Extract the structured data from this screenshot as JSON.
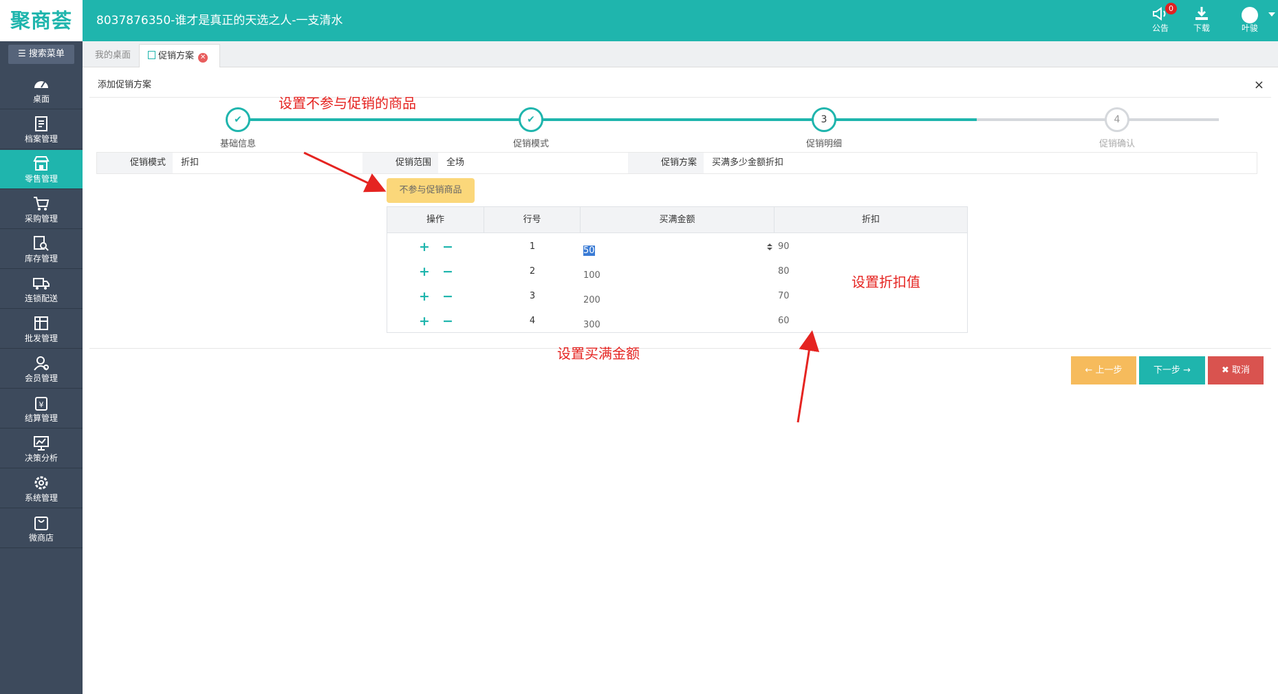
{
  "app": {
    "logo": "聚商荟",
    "title": "8037876350-谁才是真正的天选之人-一支清水",
    "notice_label": "公告",
    "notice_count": "0",
    "download_label": "下载",
    "user_name": "叶骏"
  },
  "sidebar": {
    "search_label": "搜索菜单",
    "items": [
      {
        "label": "桌面",
        "icon": "dashboard-icon"
      },
      {
        "label": "档案管理",
        "icon": "archive-icon"
      },
      {
        "label": "零售管理",
        "icon": "store-icon",
        "active": true
      },
      {
        "label": "采购管理",
        "icon": "cart-icon"
      },
      {
        "label": "库存管理",
        "icon": "inventory-search-icon"
      },
      {
        "label": "连锁配送",
        "icon": "truck-icon"
      },
      {
        "label": "批发管理",
        "icon": "wholesale-icon"
      },
      {
        "label": "会员管理",
        "icon": "member-icon"
      },
      {
        "label": "结算管理",
        "icon": "settlement-icon"
      },
      {
        "label": "决策分析",
        "icon": "analysis-icon"
      },
      {
        "label": "系统管理",
        "icon": "gear-icon"
      },
      {
        "label": "微商店",
        "icon": "shop-bag-icon"
      }
    ]
  },
  "tabs": {
    "desktop": "我的桌面",
    "promo": "促销方案"
  },
  "panel": {
    "title": "添加促销方案",
    "close": "×"
  },
  "steps": [
    {
      "number": "1",
      "label": "基础信息",
      "state": "done"
    },
    {
      "number": "2",
      "label": "促销模式",
      "state": "done"
    },
    {
      "number": "3",
      "label": "促销明细",
      "state": "current"
    },
    {
      "number": "4",
      "label": "促销确认",
      "state": "todo"
    }
  ],
  "info": {
    "mode_label": "促销模式",
    "mode_value": "折扣",
    "scope_label": "促销范围",
    "scope_value": "全场",
    "plan_label": "促销方案",
    "plan_value": "买满多少金额折扣"
  },
  "exclude_button": "不参与促销商品",
  "table": {
    "headers": [
      "操作",
      "行号",
      "买满金额",
      "折扣"
    ],
    "add_symbol": "+",
    "remove_symbol": "−",
    "rows": [
      {
        "row": "1",
        "amount": "50",
        "discount": "90"
      },
      {
        "row": "2",
        "amount": "100",
        "discount": "80"
      },
      {
        "row": "3",
        "amount": "200",
        "discount": "70"
      },
      {
        "row": "4",
        "amount": "300",
        "discount": "60"
      }
    ]
  },
  "buttons": {
    "prev": "上一步",
    "next": "下一步",
    "cancel": "取消"
  },
  "annotations": {
    "exclude_note": "设置不参与促销的商品",
    "discount_note": "设置折扣值",
    "amount_note": "设置买满金额"
  },
  "colors": {
    "brand": "#1fb5ad",
    "sidebar": "#3d4a5c",
    "warning": "#f6bb5c",
    "danger": "#d9534f",
    "annotation": "#e52421"
  }
}
